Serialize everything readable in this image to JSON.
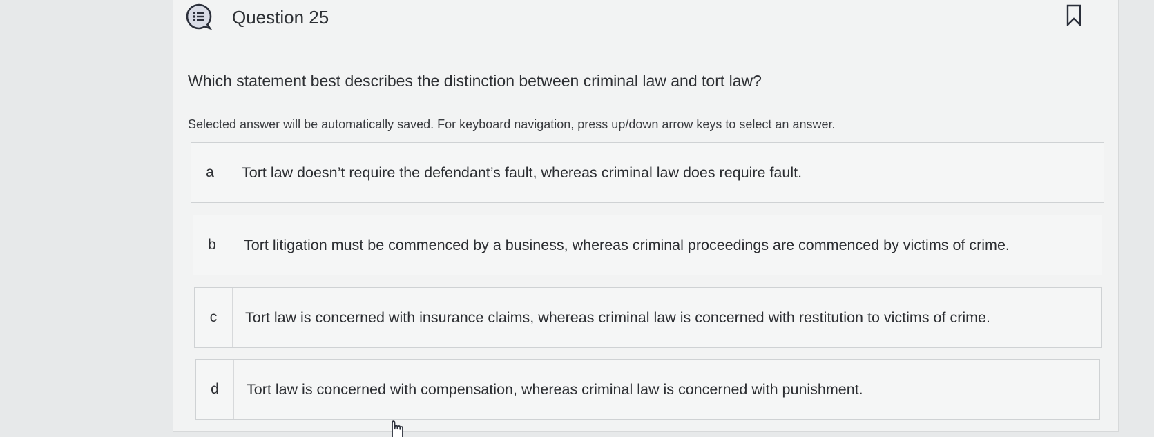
{
  "question": {
    "title": "Question 25",
    "text": "Which statement best describes the distinction between criminal law and tort law?",
    "instructions": "Selected answer will be automatically saved. For keyboard navigation, press up/down arrow keys to select an answer."
  },
  "options": [
    {
      "letter": "a",
      "text": "Tort law doesn’t require the defendant’s fault, whereas criminal law does require fault."
    },
    {
      "letter": "b",
      "text": "Tort litigation must be commenced by a business, whereas criminal proceedings are commenced by victims of crime."
    },
    {
      "letter": "c",
      "text": "Tort law is concerned with insurance claims, whereas criminal law is concerned with restitution to victims of crime."
    },
    {
      "letter": "d",
      "text": "Tort law is concerned with compensation, whereas criminal law is concerned with punishment."
    }
  ],
  "icons": {
    "question": "question-list-icon",
    "bookmark": "bookmark-icon",
    "cursor": "hand-pointer-icon"
  },
  "colors": {
    "accent": "#2b2f3a",
    "icon_bg": "#d9dce6"
  }
}
